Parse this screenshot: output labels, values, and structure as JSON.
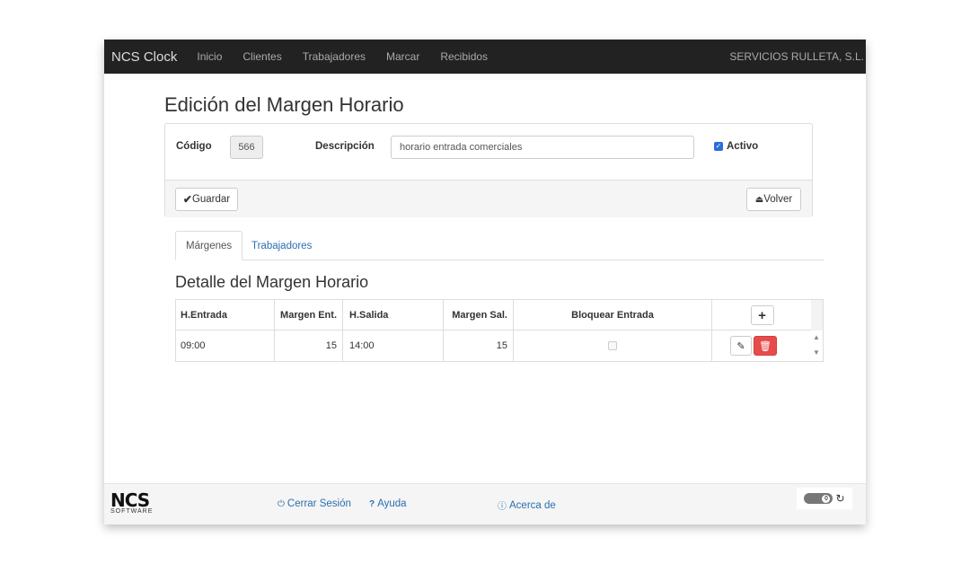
{
  "nav": {
    "brand": "NCS Clock",
    "items": [
      {
        "label": "Inicio"
      },
      {
        "label": "Clientes"
      },
      {
        "label": "Trabajadores"
      },
      {
        "label": "Marcar"
      },
      {
        "label": "Recibidos"
      }
    ],
    "company": "SERVICIOS RULLETA, S.L."
  },
  "page": {
    "title": "Edición del Margen Horario"
  },
  "form": {
    "code_label": "Código",
    "code_value": "566",
    "desc_label": "Descripción",
    "desc_value": "horario entrada comerciales",
    "active_label": "Activo",
    "active_checked": true,
    "save_label": "Guardar",
    "back_label": "Volver"
  },
  "tabs": [
    {
      "label": "Márgenes",
      "active": true
    },
    {
      "label": "Trabajadores",
      "active": false
    }
  ],
  "detail": {
    "title": "Detalle del Margen Horario",
    "columns": [
      "H.Entrada",
      "Margen Ent.",
      "H.Salida",
      "Margen Sal.",
      "Bloquear Entrada"
    ],
    "add_label": "+",
    "rows": [
      {
        "entrada": "09:00",
        "margen_ent": "15",
        "salida": "14:00",
        "margen_sal": "15",
        "bloquear": false
      }
    ]
  },
  "footer": {
    "logo_main": "NCS",
    "logo_sub": "SOFTWARE",
    "logout_label": "Cerrar Sesión",
    "help_label": "Ayuda",
    "about_label": "Acerca de",
    "counter": "0"
  },
  "colors": {
    "navbar": "#222222",
    "link": "#2a6fb0",
    "danger": "#e74c4c",
    "checkbox": "#2a6fdb"
  },
  "icons": {
    "save": "check-icon",
    "back": "eject-icon",
    "edit": "pencil-icon",
    "delete": "trash-icon",
    "logout": "power-icon",
    "help": "question-circle-icon",
    "about": "info-circle-icon",
    "refresh": "refresh-icon"
  }
}
